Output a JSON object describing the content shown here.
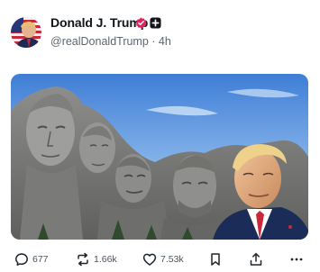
{
  "post": {
    "author": {
      "name": "Donald J. Trump",
      "handle": "@realDonaldTrump",
      "time": "4h"
    },
    "image": {
      "subject": "Mount Rushmore with Donald J. Trump"
    },
    "actions": {
      "replies": "677",
      "reposts": "1.66k",
      "likes": "7.53k"
    }
  },
  "colors": {
    "verified_badge": "#e0245e",
    "text_primary": "#0f1419",
    "text_secondary": "#5c6670"
  },
  "icons": [
    "verified-badge-icon",
    "follow-plus-icon",
    "reply-icon",
    "repost-icon",
    "like-icon",
    "bookmark-icon",
    "share-icon",
    "more-icon"
  ]
}
